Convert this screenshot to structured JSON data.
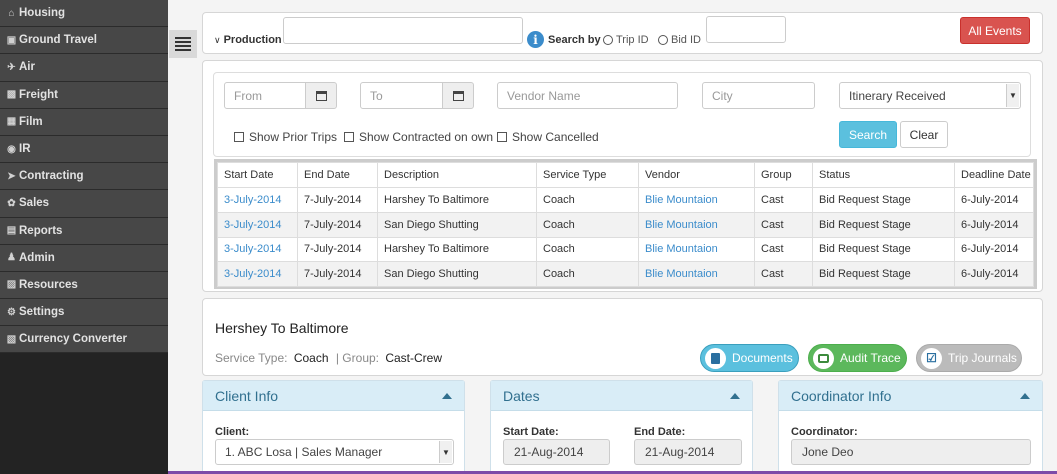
{
  "sidebar": {
    "items": [
      {
        "label": "Housing",
        "icon": "home-icon"
      },
      {
        "label": "Ground Travel",
        "icon": "car-icon"
      },
      {
        "label": "Air",
        "icon": "plane-icon"
      },
      {
        "label": "Freight",
        "icon": "truck-icon"
      },
      {
        "label": "Film",
        "icon": "film-icon"
      },
      {
        "label": "IR",
        "icon": "info-icon"
      },
      {
        "label": "Contracting",
        "icon": "send-icon"
      },
      {
        "label": "Sales",
        "icon": "tag-icon"
      },
      {
        "label": "Reports",
        "icon": "list-icon"
      },
      {
        "label": "Admin",
        "icon": "user-icon"
      },
      {
        "label": "Resources",
        "icon": "briefcase-icon"
      },
      {
        "label": "Settings",
        "icon": "gear-icon"
      },
      {
        "label": "Currency Converter",
        "icon": "calculator-icon"
      }
    ]
  },
  "top": {
    "production_label": "Production",
    "production_value": "",
    "search_by_label": "Search by",
    "trip_id_label": "Trip ID",
    "bid_id_label": "Bid ID",
    "bid_value": "",
    "all_events_label": "All Events"
  },
  "filters": {
    "from_placeholder": "From",
    "to_placeholder": "To",
    "vendor_placeholder": "Vendor Name",
    "city_placeholder": "City",
    "status_selected": "Itinerary Received",
    "show_prior": "Show Prior Trips",
    "show_contracted": "Show Contracted on own",
    "show_cancelled": "Show Cancelled",
    "search_label": "Search",
    "clear_label": "Clear"
  },
  "table": {
    "headers": [
      "Start Date",
      "End Date",
      "Description",
      "Service Type",
      "Vendor",
      "Group",
      "Status",
      "Deadline Date"
    ],
    "rows": [
      [
        "3-July-2014",
        "7-July-2014",
        "Harshey To Baltimore",
        "Coach",
        "Blie Mountaion",
        "Cast",
        "Bid Request Stage",
        "6-July-2014"
      ],
      [
        "3-July-2014",
        "7-July-2014",
        "San Diego Shutting",
        "Coach",
        "Blie Mountaion",
        "Cast",
        "Bid Request Stage",
        "6-July-2014"
      ],
      [
        "3-July-2014",
        "7-July-2014",
        "Harshey To Baltimore",
        "Coach",
        "Blie Mountaion",
        "Cast",
        "Bid Request Stage",
        "6-July-2014"
      ],
      [
        "3-July-2014",
        "7-July-2014",
        "San Diego Shutting",
        "Coach",
        "Blie Mountaion",
        "Cast",
        "Bid Request Stage",
        "6-July-2014"
      ]
    ]
  },
  "detail": {
    "title": "Hershey To Baltimore",
    "service_type_label": "Service Type:",
    "service_type_value": "Coach",
    "group_label": "| Group:",
    "group_value": "Cast-Crew",
    "documents_label": "Documents",
    "audit_label": "Audit Trace",
    "journals_label": "Trip Journals"
  },
  "client_info": {
    "title": "Client Info",
    "client_label": "Client:",
    "client_value": "1. ABC Losa | Sales Manager"
  },
  "dates": {
    "title": "Dates",
    "start_label": "Start Date:",
    "start_value": "21-Aug-2014",
    "end_label": "End Date:",
    "end_value": "21-Aug-2014"
  },
  "coordinator": {
    "title": "Coordinator Info",
    "coord_label": "Coordinator:",
    "coord_value": "Jone Deo"
  },
  "colors": {
    "sidebar_bg": "#474747",
    "accent_red": "#d9534f",
    "accent_blue": "#5bc0de",
    "link_blue": "#3b8ccb",
    "docs_pill": "#5bc0de",
    "audit_pill": "#5cb85c",
    "journal_pill": "#bbbbbb",
    "section_header": "#d9edf7"
  }
}
